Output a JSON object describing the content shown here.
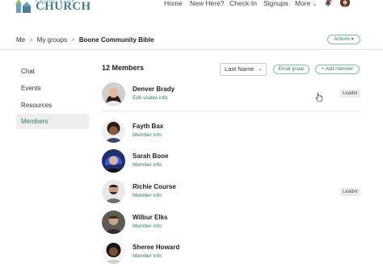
{
  "brand": {
    "logo_top": "centerville",
    "logo_main": "CHURCH"
  },
  "topnav": {
    "home": "Home",
    "new_here": "New Here?",
    "check_in": "Check-In",
    "signups": "Signups",
    "more": "More"
  },
  "breadcrumb": {
    "items": [
      "Me",
      "My groups",
      "Boone Community Bible"
    ],
    "separator": ">",
    "actions_label": "Actions"
  },
  "sidebar": {
    "items": [
      {
        "label": "Chat"
      },
      {
        "label": "Events"
      },
      {
        "label": "Resources"
      },
      {
        "label": "Members",
        "active": true
      }
    ]
  },
  "members": {
    "count_label": "12 Members",
    "sort_value": "Last Name",
    "email_group_label": "Email group",
    "add_member_label": "+ Add member",
    "leader_label": "Leader",
    "list": [
      {
        "name": "Denver Brady",
        "link": "Edit visible info",
        "leader": true
      },
      {
        "name": "Fayth Bax",
        "link": "Member info",
        "leader": false
      },
      {
        "name": "Sarah Booe",
        "link": "Member info",
        "leader": false
      },
      {
        "name": "Richie Course",
        "link": "Member info",
        "leader": true
      },
      {
        "name": "Wilbur Elks",
        "link": "Member info",
        "leader": false
      },
      {
        "name": "Sheree Howard",
        "link": "Member info",
        "leader": false
      }
    ]
  },
  "colors": {
    "accent_green": "#2f7d62",
    "brand_blue": "#4a7d96",
    "sidebar_active_bg": "#eeeeee"
  }
}
